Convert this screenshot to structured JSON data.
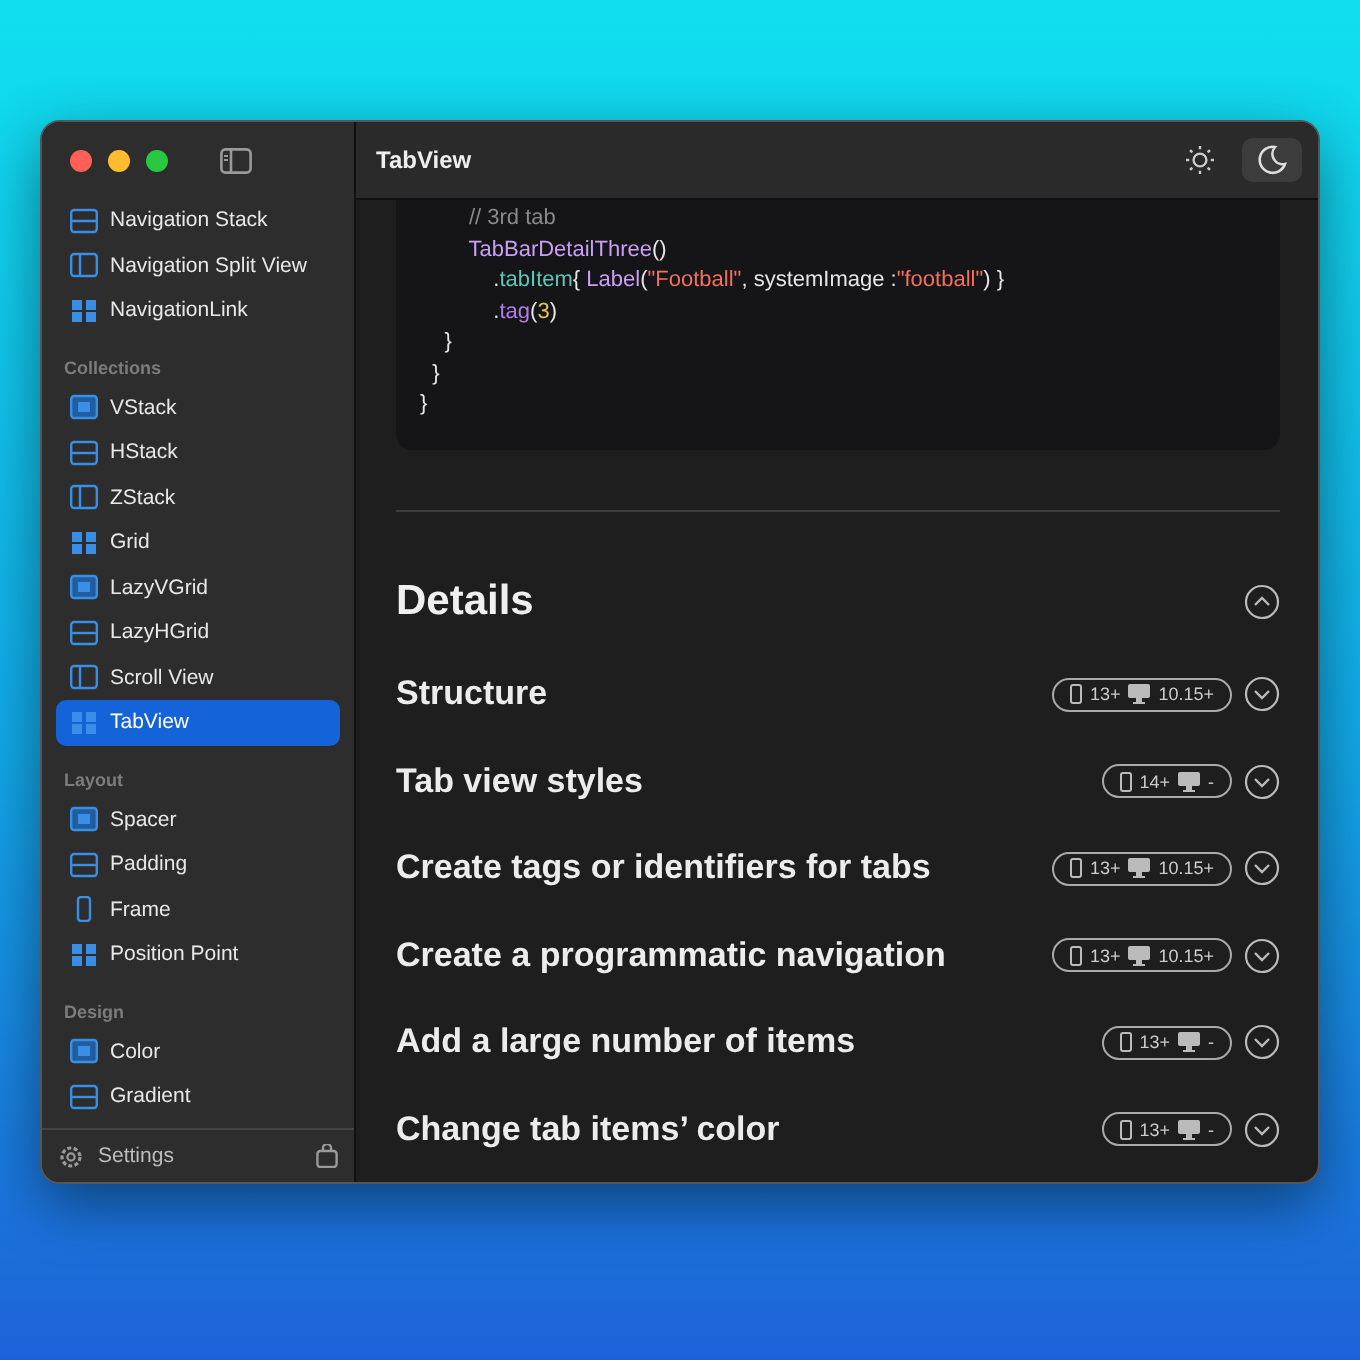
{
  "window": {
    "title": "TabView"
  },
  "toolbar": {
    "light_mode": {
      "selected": false
    },
    "dark_mode": {
      "selected": true
    }
  },
  "sidebar": {
    "sections": [
      {
        "items": [
          {
            "label": "Navigation Stack",
            "selected": false
          },
          {
            "label": "Navigation Split View",
            "selected": false
          },
          {
            "label": "NavigationLink",
            "selected": false
          }
        ]
      },
      {
        "header": "Collections",
        "items": [
          {
            "label": "VStack",
            "selected": false
          },
          {
            "label": "HStack",
            "selected": false
          },
          {
            "label": "ZStack",
            "selected": false
          },
          {
            "label": "Grid",
            "selected": false
          },
          {
            "label": "LazyVGrid",
            "selected": false
          },
          {
            "label": "LazyHGrid",
            "selected": false
          },
          {
            "label": "Scroll View",
            "selected": false
          },
          {
            "label": "TabView",
            "selected": true
          }
        ]
      },
      {
        "header": "Layout",
        "items": [
          {
            "label": "Spacer",
            "selected": false
          },
          {
            "label": "Padding",
            "selected": false
          },
          {
            "label": "Frame",
            "selected": false
          },
          {
            "label": "Position Point",
            "selected": false
          }
        ]
      },
      {
        "header": "Design",
        "items": [
          {
            "label": "Color",
            "selected": false
          },
          {
            "label": "Gradient",
            "selected": false
          }
        ]
      }
    ],
    "footer": {
      "label": "Settings"
    }
  },
  "code": [
    [
      {
        "kind": "comment",
        "text": "        // 3rd tab"
      }
    ],
    [
      {
        "kind": "type",
        "text": "        TabBarDetailThree"
      },
      {
        "kind": "plain",
        "text": "()"
      }
    ],
    [
      {
        "kind": "plain",
        "text": "            ."
      },
      {
        "kind": "method",
        "text": "tabItem"
      },
      {
        "kind": "plain",
        "text": "{ "
      },
      {
        "kind": "type",
        "text": "Label"
      },
      {
        "kind": "plain",
        "text": "("
      },
      {
        "kind": "string",
        "text": "\"Football\""
      },
      {
        "kind": "plain",
        "text": ", systemImage :"
      },
      {
        "kind": "string",
        "text": "\"football\""
      },
      {
        "kind": "plain",
        "text": ") }"
      }
    ],
    [
      {
        "kind": "plain",
        "text": "            ."
      },
      {
        "kind": "keyword",
        "text": "tag"
      },
      {
        "kind": "plain",
        "text": "("
      },
      {
        "kind": "number",
        "text": "3"
      },
      {
        "kind": "plain",
        "text": ")"
      }
    ],
    [
      {
        "kind": "plain",
        "text": "    }"
      }
    ],
    [
      {
        "kind": "plain",
        "text": "  }"
      }
    ],
    [
      {
        "kind": "plain",
        "text": "}"
      }
    ]
  ],
  "details": {
    "title": "Details",
    "expanded": true,
    "rows": [
      {
        "title": "Structure",
        "ios": "13+",
        "macos": "10.15+",
        "expanded": false
      },
      {
        "title": "Tab view styles",
        "ios": "14+",
        "macos": "-",
        "expanded": false
      },
      {
        "title": "Create tags or identifiers for tabs",
        "ios": "13+",
        "macos": "10.15+",
        "expanded": false
      },
      {
        "title": "Create a programmatic navigation",
        "ios": "13+",
        "macos": "10.15+",
        "expanded": false
      },
      {
        "title": "Add a large number of items",
        "ios": "13+",
        "macos": "-",
        "expanded": false
      },
      {
        "title": "Change tab items’ color",
        "ios": "13+",
        "macos": "-",
        "expanded": false
      }
    ]
  }
}
